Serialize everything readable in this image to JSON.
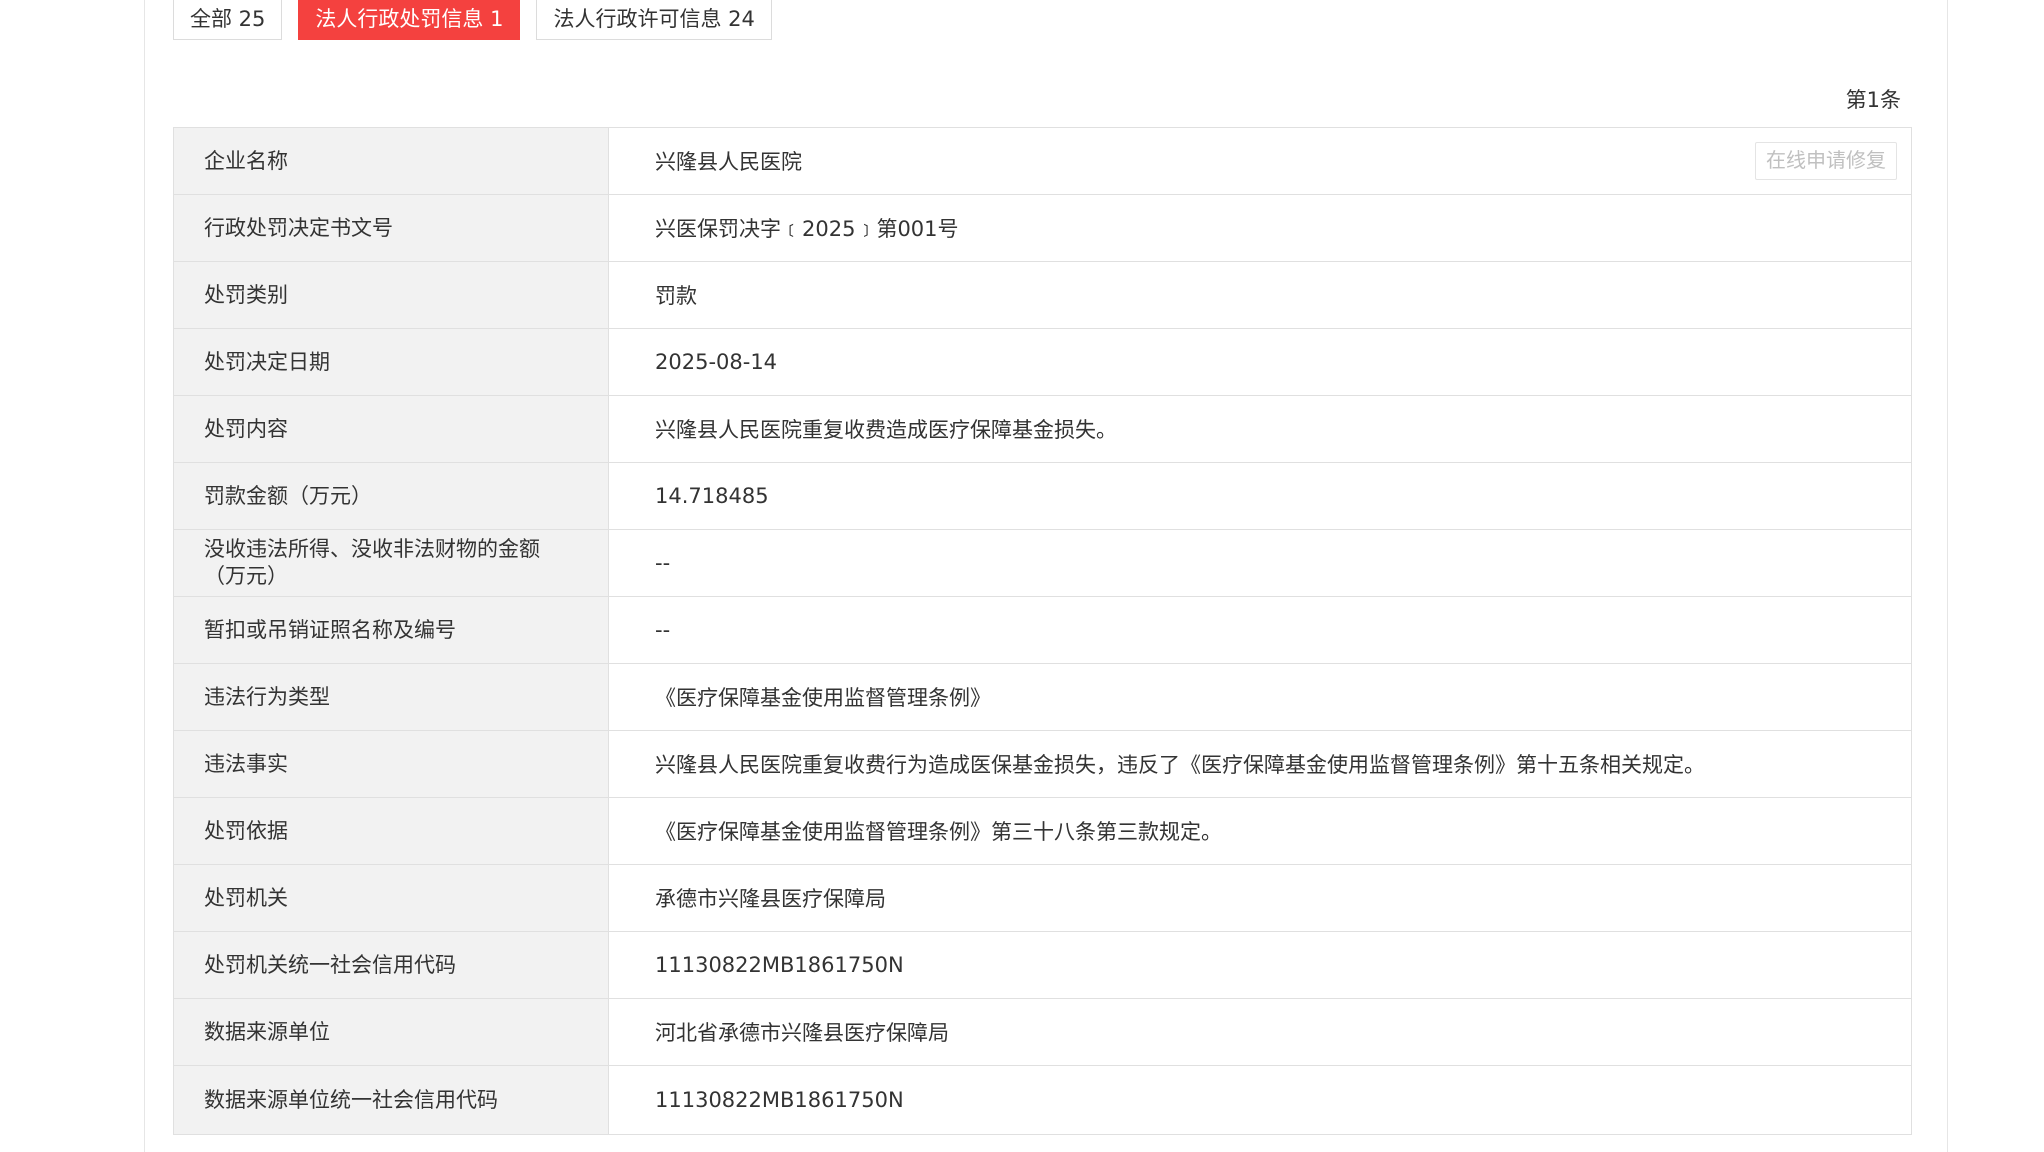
{
  "tabs": [
    {
      "label": "全部 25",
      "active": false
    },
    {
      "label": "法人行政处罚信息 1",
      "active": true
    },
    {
      "label": "法人行政许可信息 24",
      "active": false
    }
  ],
  "record_no": "第1条",
  "repair_button": "在线申请修复",
  "colors": {
    "accent": "#f4413f",
    "label_bg": "#f2f2f2",
    "border": "#e0e0e0"
  },
  "rows": [
    {
      "label": "企业名称",
      "value": "兴隆县人民医院"
    },
    {
      "label": "行政处罚决定书文号",
      "value": "兴医保罚决字﹝2025﹞第001号"
    },
    {
      "label": "处罚类别",
      "value": "罚款"
    },
    {
      "label": "处罚决定日期",
      "value": "2025-08-14"
    },
    {
      "label": "处罚内容",
      "value": "兴隆县人民医院重复收费造成医疗保障基金损失。"
    },
    {
      "label": "罚款金额（万元）",
      "value": "14.718485"
    },
    {
      "label": "没收违法所得、没收非法财物的金额（万元）",
      "value": "--"
    },
    {
      "label": "暂扣或吊销证照名称及编号",
      "value": "--"
    },
    {
      "label": "违法行为类型",
      "value": "《医疗保障基金使用监督管理条例》"
    },
    {
      "label": "违法事实",
      "value": "兴隆县人民医院重复收费行为造成医保基金损失，违反了《医疗保障基金使用监督管理条例》第十五条相关规定。"
    },
    {
      "label": "处罚依据",
      "value": "《医疗保障基金使用监督管理条例》第三十八条第三款规定。"
    },
    {
      "label": "处罚机关",
      "value": "承德市兴隆县医疗保障局"
    },
    {
      "label": "处罚机关统一社会信用代码",
      "value": "11130822MB1861750N"
    },
    {
      "label": "数据来源单位",
      "value": "河北省承德市兴隆县医疗保障局"
    },
    {
      "label": "数据来源单位统一社会信用代码",
      "value": "11130822MB1861750N"
    }
  ]
}
